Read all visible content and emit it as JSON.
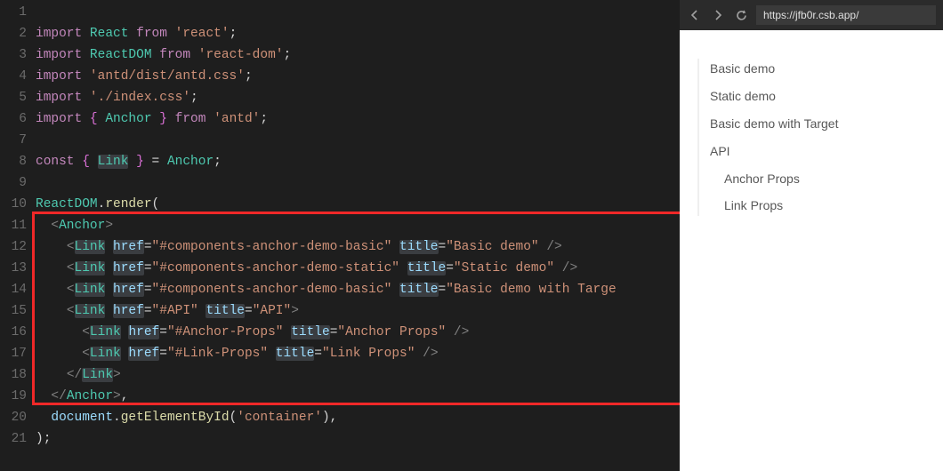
{
  "browser": {
    "url": "https://jfb0r.csb.app/"
  },
  "preview_links": [
    {
      "label": "Basic demo",
      "level": 1
    },
    {
      "label": "Static demo",
      "level": 1
    },
    {
      "label": "Basic demo with Target",
      "level": 1
    },
    {
      "label": "API",
      "level": 1
    },
    {
      "label": "Anchor Props",
      "level": 2
    },
    {
      "label": "Link Props",
      "level": 2
    }
  ],
  "code_lines": [
    {
      "n": 1,
      "segs": []
    },
    {
      "n": 2,
      "segs": [
        {
          "t": "import ",
          "cls": "tok-kw"
        },
        {
          "t": "React",
          "cls": "tok-def"
        },
        {
          "t": " from ",
          "cls": "tok-kw"
        },
        {
          "t": "'react'",
          "cls": "tok-str"
        },
        {
          "t": ";",
          "cls": "tok-pun"
        }
      ]
    },
    {
      "n": 3,
      "segs": [
        {
          "t": "import ",
          "cls": "tok-kw"
        },
        {
          "t": "ReactDOM",
          "cls": "tok-def"
        },
        {
          "t": " from ",
          "cls": "tok-kw"
        },
        {
          "t": "'react-dom'",
          "cls": "tok-str"
        },
        {
          "t": ";",
          "cls": "tok-pun"
        }
      ]
    },
    {
      "n": 4,
      "segs": [
        {
          "t": "import ",
          "cls": "tok-kw"
        },
        {
          "t": "'antd/dist/antd.css'",
          "cls": "tok-str"
        },
        {
          "t": ";",
          "cls": "tok-pun"
        }
      ]
    },
    {
      "n": 5,
      "segs": [
        {
          "t": "import ",
          "cls": "tok-kw"
        },
        {
          "t": "'./index.css'",
          "cls": "tok-str"
        },
        {
          "t": ";",
          "cls": "tok-pun"
        }
      ]
    },
    {
      "n": 6,
      "segs": [
        {
          "t": "import ",
          "cls": "tok-kw"
        },
        {
          "t": "{ ",
          "cls": "tok-brace"
        },
        {
          "t": "Anchor",
          "cls": "tok-def"
        },
        {
          "t": " }",
          "cls": "tok-brace"
        },
        {
          "t": " from ",
          "cls": "tok-kw"
        },
        {
          "t": "'antd'",
          "cls": "tok-str"
        },
        {
          "t": ";",
          "cls": "tok-pun"
        }
      ]
    },
    {
      "n": 7,
      "segs": []
    },
    {
      "n": 8,
      "segs": [
        {
          "t": "const ",
          "cls": "tok-kw"
        },
        {
          "t": "{ ",
          "cls": "tok-brace"
        },
        {
          "t": "Link",
          "cls": "tok-def",
          "hl": true
        },
        {
          "t": " }",
          "cls": "tok-brace"
        },
        {
          "t": " = ",
          "cls": "tok-pun"
        },
        {
          "t": "Anchor",
          "cls": "tok-def"
        },
        {
          "t": ";",
          "cls": "tok-pun"
        }
      ]
    },
    {
      "n": 9,
      "segs": []
    },
    {
      "n": 10,
      "segs": [
        {
          "t": "ReactDOM",
          "cls": "tok-def"
        },
        {
          "t": ".",
          "cls": "tok-pun"
        },
        {
          "t": "render",
          "cls": "tok-fn"
        },
        {
          "t": "(",
          "cls": "tok-pun"
        }
      ]
    },
    {
      "n": 11,
      "segs": [
        {
          "t": "  ",
          "cls": "tok-pun"
        },
        {
          "t": "<",
          "cls": "tok-brk"
        },
        {
          "t": "Anchor",
          "cls": "tok-tag"
        },
        {
          "t": ">",
          "cls": "tok-brk"
        }
      ]
    },
    {
      "n": 12,
      "curline": true,
      "segs": [
        {
          "t": "    ",
          "cls": "tok-pun"
        },
        {
          "t": "<",
          "cls": "tok-brk"
        },
        {
          "t": "Link",
          "cls": "tok-tag",
          "hl": true
        },
        {
          "t": " ",
          "cls": "tok-pun"
        },
        {
          "t": "href",
          "cls": "tok-attr",
          "hl": true
        },
        {
          "t": "=",
          "cls": "tok-pun"
        },
        {
          "t": "\"#components-anchor-demo-basic\"",
          "cls": "tok-str"
        },
        {
          "t": " ",
          "cls": "tok-pun"
        },
        {
          "t": "title",
          "cls": "tok-attr",
          "hl": true
        },
        {
          "t": "=",
          "cls": "tok-pun"
        },
        {
          "t": "\"Basic demo\"",
          "cls": "tok-str"
        },
        {
          "t": " />",
          "cls": "tok-brk"
        }
      ]
    },
    {
      "n": 13,
      "segs": [
        {
          "t": "    ",
          "cls": "tok-pun"
        },
        {
          "t": "<",
          "cls": "tok-brk"
        },
        {
          "t": "Link",
          "cls": "tok-tag",
          "hl": true
        },
        {
          "t": " ",
          "cls": "tok-pun"
        },
        {
          "t": "href",
          "cls": "tok-attr",
          "hl": true
        },
        {
          "t": "=",
          "cls": "tok-pun"
        },
        {
          "t": "\"#components-anchor-demo-static\"",
          "cls": "tok-str"
        },
        {
          "t": " ",
          "cls": "tok-pun"
        },
        {
          "t": "title",
          "cls": "tok-attr",
          "hl": true
        },
        {
          "t": "=",
          "cls": "tok-pun"
        },
        {
          "t": "\"Static demo\"",
          "cls": "tok-str"
        },
        {
          "t": " />",
          "cls": "tok-brk"
        }
      ]
    },
    {
      "n": 14,
      "segs": [
        {
          "t": "    ",
          "cls": "tok-pun"
        },
        {
          "t": "<",
          "cls": "tok-brk"
        },
        {
          "t": "Link",
          "cls": "tok-tag",
          "hl": true
        },
        {
          "t": " ",
          "cls": "tok-pun"
        },
        {
          "t": "href",
          "cls": "tok-attr",
          "hl": true
        },
        {
          "t": "=",
          "cls": "tok-pun"
        },
        {
          "t": "\"#components-anchor-demo-basic\"",
          "cls": "tok-str"
        },
        {
          "t": " ",
          "cls": "tok-pun"
        },
        {
          "t": "title",
          "cls": "tok-attr",
          "hl": true
        },
        {
          "t": "=",
          "cls": "tok-pun"
        },
        {
          "t": "\"Basic demo with Targe",
          "cls": "tok-str"
        }
      ]
    },
    {
      "n": 15,
      "segs": [
        {
          "t": "    ",
          "cls": "tok-pun"
        },
        {
          "t": "<",
          "cls": "tok-brk"
        },
        {
          "t": "Link",
          "cls": "tok-tag",
          "hl": true
        },
        {
          "t": " ",
          "cls": "tok-pun"
        },
        {
          "t": "href",
          "cls": "tok-attr",
          "hl": true
        },
        {
          "t": "=",
          "cls": "tok-pun"
        },
        {
          "t": "\"#API\"",
          "cls": "tok-str"
        },
        {
          "t": " ",
          "cls": "tok-pun"
        },
        {
          "t": "title",
          "cls": "tok-attr",
          "hl": true
        },
        {
          "t": "=",
          "cls": "tok-pun"
        },
        {
          "t": "\"API\"",
          "cls": "tok-str"
        },
        {
          "t": ">",
          "cls": "tok-brk"
        }
      ]
    },
    {
      "n": 16,
      "segs": [
        {
          "t": "      ",
          "cls": "tok-pun"
        },
        {
          "t": "<",
          "cls": "tok-brk"
        },
        {
          "t": "Link",
          "cls": "tok-tag",
          "hl": true
        },
        {
          "t": " ",
          "cls": "tok-pun"
        },
        {
          "t": "href",
          "cls": "tok-attr",
          "hl": true
        },
        {
          "t": "=",
          "cls": "tok-pun"
        },
        {
          "t": "\"#Anchor-Props\"",
          "cls": "tok-str"
        },
        {
          "t": " ",
          "cls": "tok-pun"
        },
        {
          "t": "title",
          "cls": "tok-attr",
          "hl": true
        },
        {
          "t": "=",
          "cls": "tok-pun"
        },
        {
          "t": "\"Anchor Props\"",
          "cls": "tok-str"
        },
        {
          "t": " />",
          "cls": "tok-brk"
        }
      ]
    },
    {
      "n": 17,
      "segs": [
        {
          "t": "      ",
          "cls": "tok-pun"
        },
        {
          "t": "<",
          "cls": "tok-brk"
        },
        {
          "t": "Link",
          "cls": "tok-tag",
          "hl": true
        },
        {
          "t": " ",
          "cls": "tok-pun"
        },
        {
          "t": "href",
          "cls": "tok-attr",
          "hl": true
        },
        {
          "t": "=",
          "cls": "tok-pun"
        },
        {
          "t": "\"#Link-Props\"",
          "cls": "tok-str"
        },
        {
          "t": " ",
          "cls": "tok-pun"
        },
        {
          "t": "title",
          "cls": "tok-attr",
          "hl": true
        },
        {
          "t": "=",
          "cls": "tok-pun"
        },
        {
          "t": "\"Link Props\"",
          "cls": "tok-str"
        },
        {
          "t": " />",
          "cls": "tok-brk"
        }
      ]
    },
    {
      "n": 18,
      "segs": [
        {
          "t": "    ",
          "cls": "tok-pun"
        },
        {
          "t": "</",
          "cls": "tok-brk"
        },
        {
          "t": "Link",
          "cls": "tok-tag",
          "hl": true
        },
        {
          "t": ">",
          "cls": "tok-brk"
        }
      ]
    },
    {
      "n": 19,
      "segs": [
        {
          "t": "  ",
          "cls": "tok-pun"
        },
        {
          "t": "</",
          "cls": "tok-brk"
        },
        {
          "t": "Anchor",
          "cls": "tok-tag"
        },
        {
          "t": ">",
          "cls": "tok-brk"
        },
        {
          "t": ",",
          "cls": "tok-pun"
        }
      ]
    },
    {
      "n": 20,
      "segs": [
        {
          "t": "  ",
          "cls": "tok-pun"
        },
        {
          "t": "document",
          "cls": "tok-var"
        },
        {
          "t": ".",
          "cls": "tok-pun"
        },
        {
          "t": "getElementById",
          "cls": "tok-fn"
        },
        {
          "t": "(",
          "cls": "tok-pun"
        },
        {
          "t": "'container'",
          "cls": "tok-str"
        },
        {
          "t": "),",
          "cls": "tok-pun"
        }
      ]
    },
    {
      "n": 21,
      "segs": [
        {
          "t": ");",
          "cls": "tok-pun"
        }
      ]
    }
  ]
}
